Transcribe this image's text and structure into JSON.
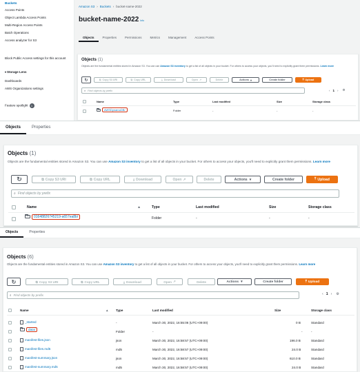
{
  "panel1": {
    "sidebar": {
      "items": [
        "Buckets",
        "Access Points",
        "Object Lambda Access Points",
        "Multi-Region Access Points",
        "Batch Operations",
        "Access analyzer for S3"
      ],
      "block_public": "Block Public Access settings for this account",
      "storage_lens": "Storage Lens",
      "lens_items": [
        "Dashboards",
        "AWS Organizations settings"
      ],
      "feature_spotlight": "Feature spotlight",
      "feature_badge": "1"
    },
    "breadcrumb": [
      "Amazon S3",
      "Buckets",
      "bucket-name-2022"
    ],
    "title": "bucket-name-2022",
    "info": "Info",
    "tabs": [
      "Objects",
      "Properties",
      "Permissions",
      "Metrics",
      "Management",
      "Access Points"
    ],
    "objects_heading": "Objects",
    "objects_count": "(1)",
    "desc_a": "Objects are the fundamental entities stored in Amazon S3. You can use ",
    "desc_link": "Amazon S3 inventory",
    "desc_b": " to get a list of all objects in your bucket. For others to access your objects, you'll need to explicitly grant them permissions. ",
    "learn_more": "Learn more",
    "buttons": {
      "copy_s3_uri": "Copy S3 URI",
      "copy_url": "Copy URL",
      "download": "Download",
      "open": "Open",
      "delete": "Delete",
      "actions": "Actions",
      "create_folder": "Create folder",
      "upload": "Upload"
    },
    "search_placeholder": "Find objects by prefix",
    "page": "1",
    "columns": [
      "Name",
      "Type",
      "Last modified",
      "Size",
      "Storage class"
    ],
    "rows": [
      {
        "name": "AWSDynamoDB/",
        "type": "Folder",
        "last_modified": "-",
        "size": "-",
        "storage_class": "-"
      }
    ]
  },
  "panel2": {
    "tabs": [
      "Objects",
      "Properties"
    ],
    "objects_heading": "Objects",
    "objects_count": "(1)",
    "desc_a": "Objects are the fundamental entities stored in Amazon S3. You can use ",
    "desc_link": "Amazon S3 inventory",
    "desc_b": " to get a list of all objects in your bucket. For others to access your objects, you'll need to explicitly grant them permissions. ",
    "learn_more": "Learn more",
    "buttons": {
      "copy_s3_uri": "Copy S3 URI",
      "copy_url": "Copy URL",
      "download": "Download",
      "open": "Open",
      "delete": "Delete",
      "actions": "Actions",
      "create_folder": "Create folder",
      "upload": "Upload"
    },
    "search_placeholder": "Find objects by prefix",
    "columns": [
      "Name",
      "Type",
      "Last modified",
      "Size",
      "Storage class"
    ],
    "rows": [
      {
        "name": "01648826745219-a657ea8b/",
        "type": "Folder",
        "last_modified": "-",
        "size": "-",
        "storage_class": "-"
      }
    ]
  },
  "panel3": {
    "tabs": [
      "Objects",
      "Properties"
    ],
    "objects_heading": "Objects",
    "objects_count": "(6)",
    "desc_a": "Objects are the fundamental entities stored in Amazon S3. You can use ",
    "desc_link": "Amazon S3 inventory",
    "desc_b": " to get a list of all objects in your bucket. For others to access your objects, you'll need to explicitly grant them permissions. ",
    "learn_more": "Learn more",
    "buttons": {
      "copy_s3_uri": "Copy S3 URI",
      "copy_url": "Copy URL",
      "download": "Download",
      "open": "Open",
      "delete": "Delete",
      "actions": "Actions",
      "create_folder": "Create folder",
      "upload": "Upload"
    },
    "search_placeholder": "Find objects by prefix",
    "page": "1",
    "columns": [
      "Name",
      "Type",
      "Last modified",
      "Size",
      "Storage class"
    ],
    "rows": [
      {
        "name": "_started",
        "type": "-",
        "last_modified": "March 30, 2022, 16:55:06 (UTC+09:00)",
        "size": "0 B",
        "storage_class": "Standard"
      },
      {
        "name": "data/",
        "type": "Folder",
        "last_modified": "-",
        "size": "-",
        "storage_class": "-"
      },
      {
        "name": "manifest-files.json",
        "type": "json",
        "last_modified": "March 30, 2022, 16:58:57 (UTC+09:00)",
        "size": "196.0 B",
        "storage_class": "Standard"
      },
      {
        "name": "manifest-files.md5",
        "type": "md5",
        "last_modified": "March 30, 2022, 16:58:57 (UTC+09:00)",
        "size": "24.0 B",
        "storage_class": "Standard"
      },
      {
        "name": "manifest-summary.json",
        "type": "json",
        "last_modified": "March 30, 2022, 16:58:57 (UTC+09:00)",
        "size": "610.0 B",
        "storage_class": "Standard"
      },
      {
        "name": "manifest-summary.md5",
        "type": "md5",
        "last_modified": "March 30, 2022, 16:58:57 (UTC+09:00)",
        "size": "24.0 B",
        "storage_class": "Standard"
      }
    ]
  },
  "colors": {
    "accent": "#ec7211",
    "link": "#0073bb",
    "highlight": "#d13212"
  }
}
